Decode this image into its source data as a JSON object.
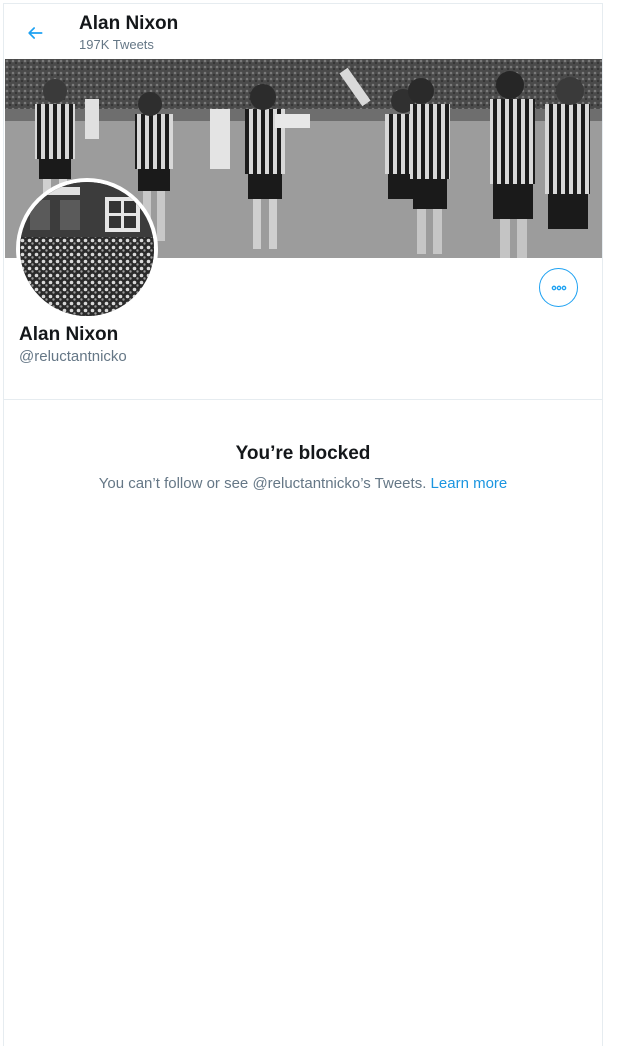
{
  "header": {
    "title": "Alan Nixon",
    "tweet_count": "197K Tweets",
    "back_icon": "arrow-left-icon"
  },
  "profile": {
    "name": "Alan Nixon",
    "handle": "@reluctantnicko",
    "more_icon": "more-horizontal-icon"
  },
  "blocked": {
    "title": "You’re blocked",
    "message": "You can’t follow or see @reluctantnicko’s Tweets.",
    "learn_more": "Learn more"
  },
  "colors": {
    "accent": "#1da1f2",
    "link": "#1b95e0",
    "secondary_text": "#657786",
    "primary_text": "#14171a",
    "border": "#e6ecf0"
  }
}
